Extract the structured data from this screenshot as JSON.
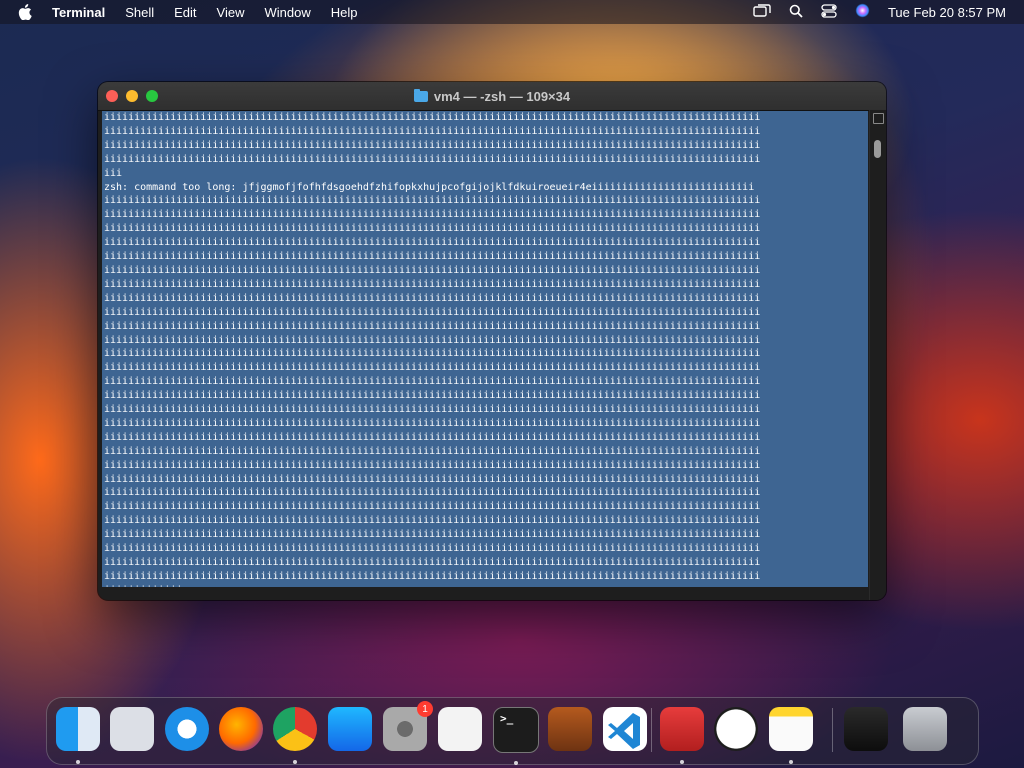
{
  "menubar": {
    "apple_icon": "apple-logo-icon",
    "app_name": "Terminal",
    "menus": [
      "Shell",
      "Edit",
      "View",
      "Window",
      "Help"
    ],
    "status_icons": [
      "screen-mirroring-icon",
      "spotlight-search-icon",
      "control-center-icon",
      "siri-icon"
    ],
    "clock": "Tue Feb 20  8:57 PM"
  },
  "window": {
    "title": "vm4 — -zsh — 109×34",
    "title_icon": "folder-icon",
    "selection_color": "#3e6592",
    "error_line": "zsh: command too long: jfjggmofjfofhfdsgoehdfzhifopkxhujpcofgijojklfdkuiroeueir4eiiiiiiiiiiiiiiiiiiiiiiiiiii",
    "repeat_char": "i",
    "leading_full_lines": 4,
    "short_line": "iii",
    "trailing_full_lines": 28,
    "last_line": "iiiiiiiiiiiii"
  },
  "dock": {
    "apps": [
      {
        "name": "finder",
        "icon": "finder-icon",
        "running": true
      },
      {
        "name": "launchpad",
        "icon": "launchpad-icon",
        "running": false
      },
      {
        "name": "safari",
        "icon": "safari-icon",
        "running": false
      },
      {
        "name": "firefox",
        "icon": "firefox-icon",
        "running": false
      },
      {
        "name": "chrome",
        "icon": "chrome-icon",
        "running": true
      },
      {
        "name": "app-store",
        "icon": "app-store-icon",
        "running": false
      },
      {
        "name": "system-settings",
        "icon": "system-settings-icon",
        "running": false,
        "badge": "1"
      },
      {
        "name": "textedit",
        "icon": "textedit-icon",
        "running": false
      },
      {
        "name": "terminal",
        "icon": "terminal-icon",
        "running": true
      },
      {
        "name": "garageband",
        "icon": "garageband-icon",
        "running": false
      },
      {
        "name": "vscode",
        "icon": "vscode-icon",
        "running": false
      },
      {
        "name": "photo-booth",
        "icon": "photo-booth-icon",
        "running": true
      },
      {
        "name": "clock",
        "icon": "clock-icon",
        "running": false
      },
      {
        "name": "notes",
        "icon": "notes-icon",
        "running": true
      },
      {
        "name": "screen-recording",
        "icon": "screen-recording-icon",
        "running": false
      },
      {
        "name": "trash",
        "icon": "trash-icon",
        "running": false
      }
    ]
  }
}
